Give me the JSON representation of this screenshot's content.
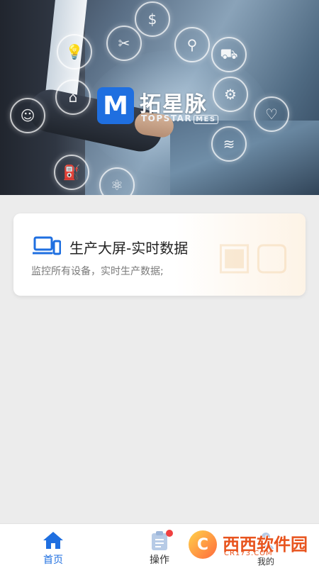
{
  "hero": {
    "brand_mark": "M",
    "brand_name": "拓星脉",
    "brand_sub": "TOPSTAR",
    "brand_tag": "MES",
    "icons": [
      "dollar-icon",
      "wrench-icon",
      "lightbulb-icon",
      "search-icon",
      "truck-icon",
      "factory-icon",
      "robot-arm-icon",
      "person-icon",
      "handshake-icon",
      "wifi-icon",
      "oil-pump-icon",
      "atom-icon"
    ]
  },
  "card": {
    "title": "生产大屏-实时数据",
    "description": "监控所有设备，实时生产数据;",
    "accent": "#1f6fe0"
  },
  "tabbar": {
    "tabs": [
      {
        "label": "首页",
        "icon": "home-icon",
        "active": true
      },
      {
        "label": "操作",
        "icon": "clipboard-icon",
        "active": false,
        "badge": true
      },
      {
        "label": "我的",
        "icon": "user-icon",
        "active": false
      }
    ]
  },
  "watermark": {
    "text": "西西软件园",
    "url": "CR173.COM"
  },
  "colors": {
    "primary": "#1f6fe0",
    "badge": "#f04040",
    "background": "#ececec"
  }
}
